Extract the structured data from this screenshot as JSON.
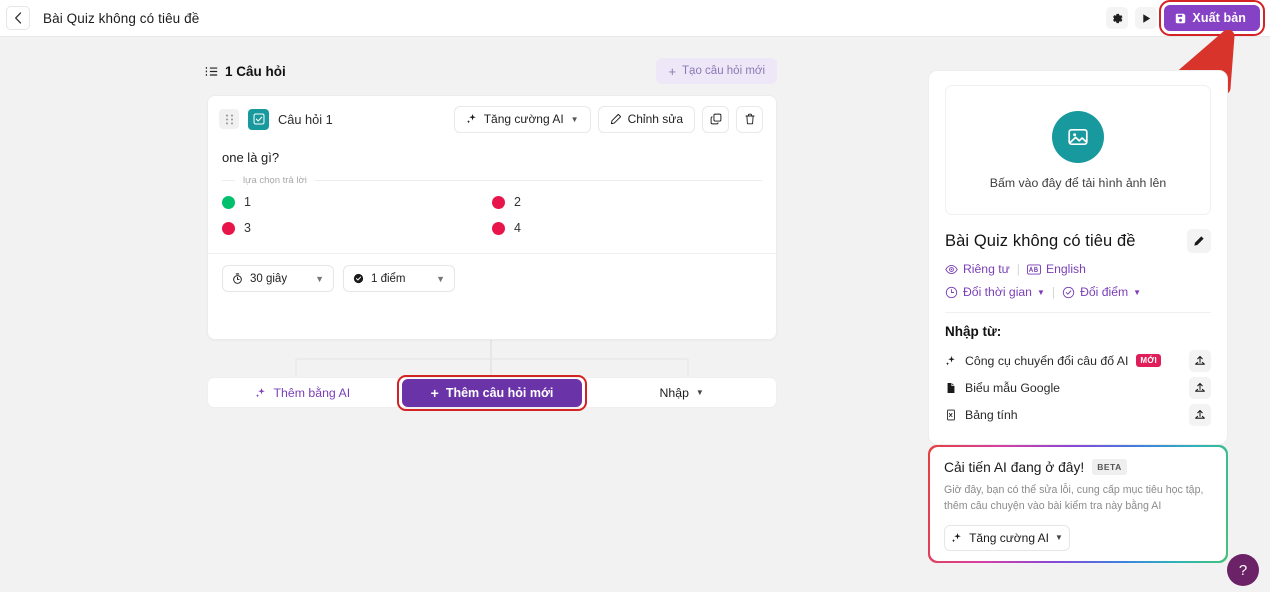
{
  "topbar": {
    "back_icon": "chevron-left-icon",
    "title": "Bài Quiz không có tiêu đề",
    "settings_icon": "gear-icon",
    "preview_icon": "play-icon",
    "publish_label": "Xuất bản",
    "publish_icon": "save-icon",
    "publish_color": "#8642c4",
    "highlight_color": "#d32323"
  },
  "questions_header": {
    "list_icon": "list-ordered-icon",
    "count_label": "1 Câu hỏi",
    "create_label": "Tạo câu hỏi mới",
    "create_icon": "plus-icon"
  },
  "question_card": {
    "drag_icon": "drag-handle-icon",
    "type_icon": "checkbox-icon",
    "type_icon_color": "#18999e",
    "title": "Câu hỏi 1",
    "ai_label": "Tăng cường AI",
    "ai_icon": "sparkles-icon",
    "edit_label": "Chỉnh sửa",
    "edit_icon": "pencil-icon",
    "duplicate_icon": "copy-icon",
    "delete_icon": "trash-icon",
    "question_text": "one là gì?",
    "answers_legend": "lựa chọn trả lời",
    "answers": [
      {
        "label": "1",
        "correct": true,
        "color": "#00c06d"
      },
      {
        "label": "2",
        "correct": false,
        "color": "#e8154b"
      },
      {
        "label": "3",
        "correct": false,
        "color": "#e8154b"
      },
      {
        "label": "4",
        "correct": false,
        "color": "#e8154b"
      }
    ],
    "time_value": "30 giây",
    "time_icon": "timer-icon",
    "points_value": "1 điểm",
    "points_icon": "check-circle-icon",
    "caret_icon": "chevron-down-icon"
  },
  "action_row": {
    "ai_label": "Thêm bằng AI",
    "ai_icon": "sparkles-icon",
    "add_label": "Thêm câu hỏi mới",
    "add_icon": "plus-icon",
    "import_label": "Nhập",
    "import_caret_icon": "chevron-down-icon"
  },
  "side_panel": {
    "image_icon": "image-icon",
    "image_icon_color": "#18999e",
    "upload_text": "Bấm vào đây để tải hình ảnh lên",
    "quiz_title": "Bài Quiz không có tiêu đề",
    "edit_icon": "pencil-icon",
    "visibility_icon": "eye-icon",
    "visibility_label": "Riêng tư",
    "language_icon": "language-icon",
    "language_label": "English",
    "time_icon": "clock-icon",
    "time_label": "Đổi thời gian",
    "points_icon": "check-circle-icon",
    "points_label": "Đổi điểm",
    "caret_icon": "chevron-down-icon",
    "import_title": "Nhập từ:",
    "import_items": [
      {
        "icon": "sparkles-icon",
        "label": "Công cụ chuyển đổi câu đố AI",
        "badge": "MỚI",
        "upload_icon": "upload-icon"
      },
      {
        "icon": "doc-icon",
        "label": "Biểu mẫu Google",
        "badge": "",
        "upload_icon": "upload-icon"
      },
      {
        "icon": "spreadsheet-icon",
        "label": "Bảng tính",
        "badge": "",
        "upload_icon": "upload-icon"
      }
    ]
  },
  "ai_promo": {
    "title": "Cải tiến AI đang ở đây!",
    "badge": "BETA",
    "description": "Giờ đây, bạn có thể sửa lỗi, cung cấp mục tiêu học tập, thêm câu chuyện vào bài kiểm tra này bằng AI",
    "button_label": "Tăng cường AI",
    "button_icon": "sparkles-icon",
    "caret_icon": "chevron-down-icon"
  },
  "help": {
    "label": "?",
    "icon": "question-mark-icon",
    "color": "#6b2266"
  },
  "annotation": {
    "arrow_icon": "red-arrow-up-right",
    "color": "#d8342c"
  }
}
